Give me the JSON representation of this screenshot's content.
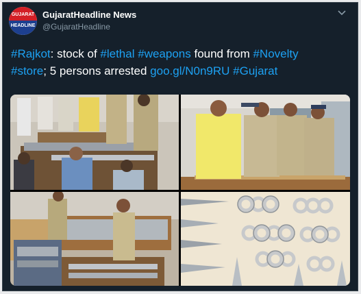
{
  "account": {
    "avatar_top": "GUJARAT",
    "avatar_bottom": "HEADLINE",
    "name": "GujaratHeadline News",
    "handle": "@GujaratHeadline"
  },
  "tweet": {
    "h_rajkot": "#Rajkot",
    "t1": ": stock of ",
    "h_lethal": "#lethal",
    "t2": " ",
    "h_weapons": "#weapons",
    "t3": " found from ",
    "h_novelty": "#Novelty",
    "h_store": "#store",
    "t4": "; 5 persons arrested ",
    "link": "goo.gl/N0n9RU",
    "t5": " ",
    "h_gujarat": "#Gujarat"
  },
  "icons": {
    "menu": "chevron-down-icon"
  },
  "colors": {
    "background": "#15202b",
    "link": "#1da1f2",
    "muted": "#8899a6",
    "border": "#38444d"
  }
}
